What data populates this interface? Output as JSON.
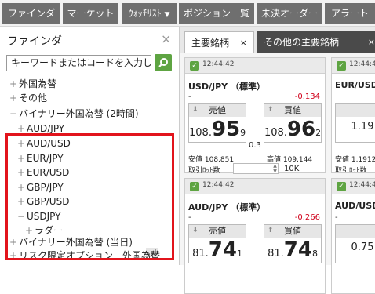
{
  "nav": {
    "items": [
      {
        "label": "ファインダ"
      },
      {
        "label": "マーケット"
      },
      {
        "label": "ｳｫｯﾁﾘｽﾄ",
        "caret": "▼"
      },
      {
        "label": "ポジション一覧"
      },
      {
        "label": "未決オーダー"
      },
      {
        "label": "アラート"
      }
    ]
  },
  "finder": {
    "title": "ファインダ",
    "close": "×",
    "search_value": "キーワードまたはコードを入力して",
    "tree": [
      {
        "sign": "+",
        "label": "外国為替"
      },
      {
        "sign": "+",
        "label": "その他"
      },
      {
        "sign": "−",
        "label": "バイナリー外国為替 (2時間)"
      },
      {
        "sign": "+",
        "label": "AUD/JPY"
      },
      {
        "sign": "+",
        "label": "AUD/USD"
      },
      {
        "sign": "+",
        "label": "EUR/JPY"
      },
      {
        "sign": "+",
        "label": "EUR/USD"
      },
      {
        "sign": "+",
        "label": "GBP/JPY"
      },
      {
        "sign": "+",
        "label": "GBP/USD"
      },
      {
        "sign": "−",
        "label": "USDJPY"
      },
      {
        "sign": "+",
        "label": "ラダー"
      },
      {
        "sign": "+",
        "label": "バイナリー外国為替 (当日)"
      },
      {
        "sign": "+",
        "label": "リスク限定オプション - 外国為替"
      }
    ]
  },
  "tabs": [
    {
      "label": "主要銘柄",
      "close": "×"
    },
    {
      "label": "その他の主要銘柄",
      "close": "×"
    }
  ],
  "cards": [
    {
      "time": "12:44:42",
      "pair": "USD/JPY （標準）",
      "dash": "-",
      "change": "-0.134",
      "sell_label": "売値",
      "buy_label": "買値",
      "sell": {
        "pre": "108.",
        "big": "95",
        "post": "9"
      },
      "buy": {
        "pre": "108.",
        "big": "96",
        "post": "2"
      },
      "spread": "0.3",
      "low": "安値 108.851",
      "high": "高値 109.144",
      "lot_label": "取引ﾛｯﾄ数",
      "lot_value": "10K"
    },
    {
      "time": "12:44:42",
      "pair": "AUD/JPY （標準）",
      "dash": "-",
      "change": "-0.266",
      "sell_label": "売値",
      "buy_label": "買値",
      "sell": {
        "pre": "81.",
        "big": "74",
        "post": "1"
      },
      "buy": {
        "pre": "81.",
        "big": "74",
        "post": "8"
      }
    }
  ],
  "partial_cards": [
    {
      "time": "12:44:42",
      "pair": "EUR/USD",
      "price": "1.19",
      "low": "安値 1.1912",
      "lot_label": "取引ﾛｯﾄ数"
    },
    {
      "time": "12:44:42",
      "pair": "AUD/USD",
      "dash": "-",
      "price": "0.75"
    }
  ]
}
